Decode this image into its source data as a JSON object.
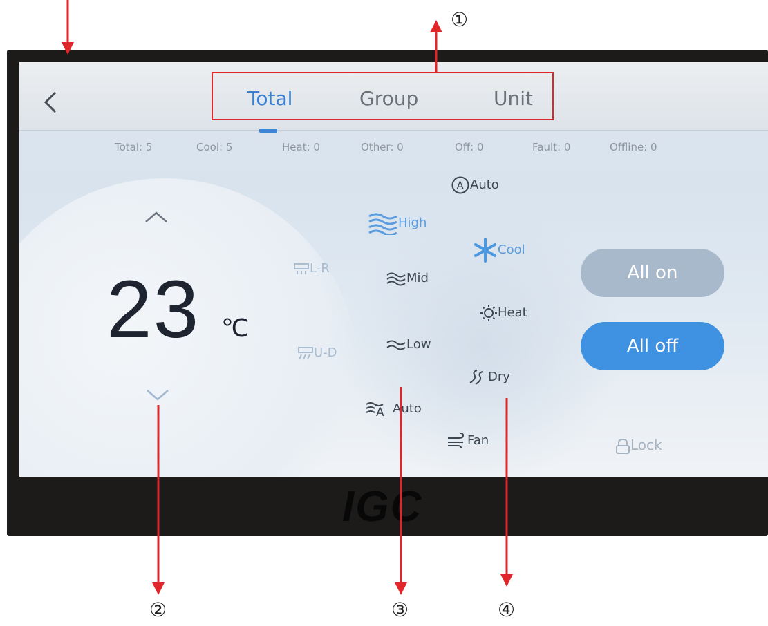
{
  "tabs": [
    "Total",
    "Group",
    "Unit"
  ],
  "status": {
    "total": "Total: 5",
    "cool": "Cool: 5",
    "heat": "Heat: 0",
    "other": "Other: 0",
    "off": "Off: 0",
    "fault": "Fault: 0",
    "offline": "Offline: 0"
  },
  "temperature": {
    "value": "23",
    "unit": "℃"
  },
  "swing": {
    "lr": "L-R",
    "ud": "U-D"
  },
  "fan_speed": {
    "high": "High",
    "mid": "Mid",
    "low": "Low",
    "auto": "Auto",
    "selected": "High"
  },
  "mode": {
    "auto": "Auto",
    "cool": "Cool",
    "heat": "Heat",
    "dry": "Dry",
    "fan": "Fan",
    "selected": "Cool"
  },
  "buttons": {
    "all_on": "All on",
    "all_off": "All off",
    "lock": "Lock"
  },
  "brand": "IGC",
  "annotations": {
    "n1": "①",
    "n2": "②",
    "n3": "③",
    "n4": "④"
  },
  "colors": {
    "accent": "#3f92e2",
    "annotation": "#e1262b",
    "inactive_pill": "#a8b9cc"
  }
}
